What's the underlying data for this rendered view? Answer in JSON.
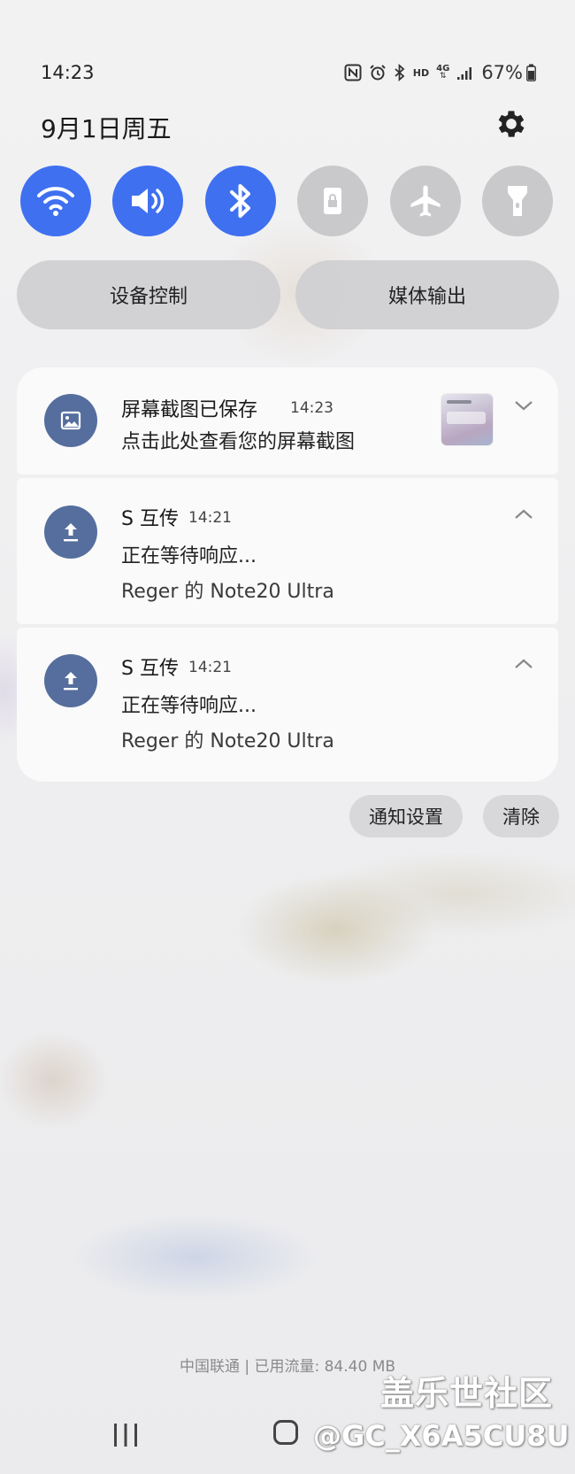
{
  "status_bar": {
    "time": "14:23",
    "network_type": "4G",
    "hd_label": "HD",
    "battery": "67%",
    "icons": [
      "nfc-icon",
      "alarm-icon",
      "bluetooth-icon",
      "hd-icon",
      "4g-icon",
      "signal-icon",
      "battery-icon"
    ]
  },
  "header": {
    "date": "9月1日周五"
  },
  "quick_toggles": [
    {
      "name": "wifi",
      "state": "on"
    },
    {
      "name": "sound",
      "state": "on"
    },
    {
      "name": "bluetooth",
      "state": "on"
    },
    {
      "name": "screen-lock",
      "state": "off"
    },
    {
      "name": "airplane",
      "state": "off"
    },
    {
      "name": "flashlight",
      "state": "off"
    }
  ],
  "buttons": {
    "device_control": "设备控制",
    "media_output": "媒体输出"
  },
  "notifications": [
    {
      "app": "screenshot",
      "title": "屏幕截图已保存",
      "time": "14:23",
      "text": "点击此处查看您的屏幕截图"
    },
    {
      "app": "S 互传",
      "time": "14:21",
      "text": "正在等待响应...",
      "sub": "Reger 的 Note20 Ultra"
    },
    {
      "app": "S 互传",
      "time": "14:21",
      "text": "正在等待响应...",
      "sub": "Reger 的 Note20 Ultra"
    }
  ],
  "actions": {
    "notification_settings": "通知设置",
    "clear": "清除"
  },
  "footer": {
    "carrier_info": "中国联通 | 已用流量: 84.40 MB"
  },
  "watermark": {
    "site": "盖乐世社区",
    "user": "@GC_X6A5CU8U"
  },
  "colors": {
    "accent": "#3f70f0",
    "toggle_off": "#c9c9cc",
    "app_icon": "#566e9d"
  }
}
